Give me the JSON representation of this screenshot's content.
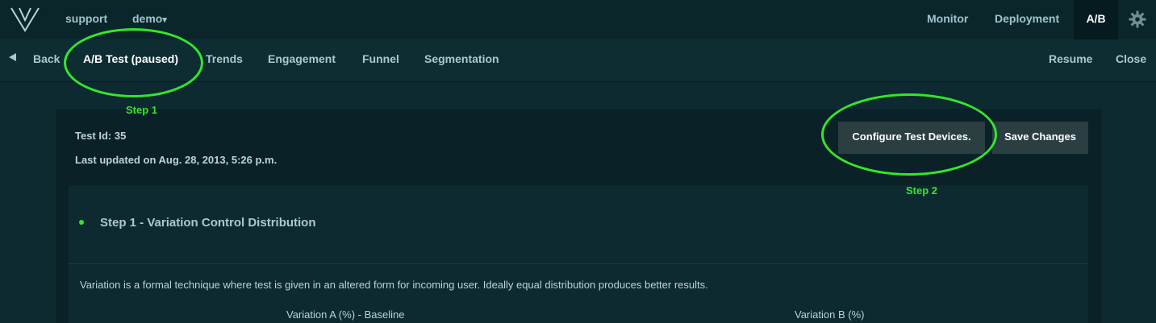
{
  "topbar": {
    "logo_icon": "v-logo-icon",
    "left_links": [
      "support",
      "demo"
    ],
    "demo_caret": "▾",
    "right_links": [
      "Monitor",
      "Deployment"
    ],
    "active": "A/B",
    "settings_icon": "gear-icon"
  },
  "subbar": {
    "back_icon": "back-arrow-icon",
    "back_label": "Back",
    "tabs": [
      "A/B Test (paused)",
      "Trends",
      "Engagement",
      "Funnel",
      "Segmentation"
    ],
    "resume_label": "Resume",
    "close_label": "Close"
  },
  "annotations": {
    "step1": "Step 1",
    "step2": "Step 2",
    "color": "#35e62b"
  },
  "test": {
    "id_text": "Test Id: 35",
    "updated_text": "Last updated on Aug. 28, 2013, 5:26 p.m.",
    "configure_button": "Configure Test Devices.",
    "save_button": "Save Changes"
  },
  "section": {
    "title": "Step 1 - Variation Control Distribution",
    "description": "Variation is a formal technique where test is given in an altered form for incoming user. Ideally equal distribution produces better results.",
    "variation_a_label": "Variation A (%) - Baseline",
    "variation_b_label": "Variation B (%)"
  }
}
